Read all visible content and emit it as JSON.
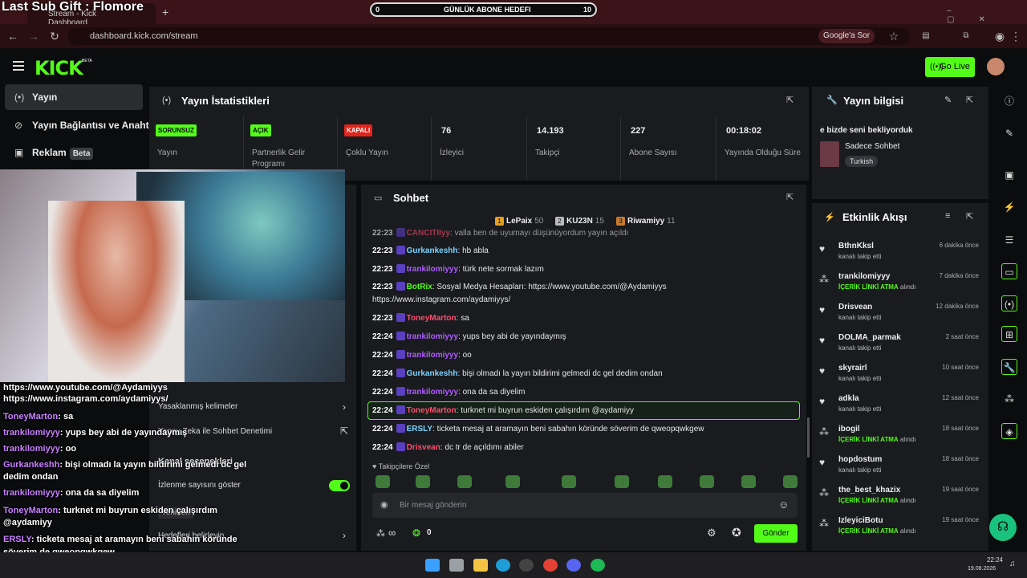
{
  "overlay": {
    "subgift": "Last Sub Gift : Flomore",
    "goal": {
      "label": "GÜNLÜK ABONE HEDEFI",
      "current": "0",
      "target": "10"
    }
  },
  "browser": {
    "tab_title": "Stream - Kick Dashboard",
    "url": "dashboard.kick.com/stream",
    "google_chip": "Google'a Sor"
  },
  "header": {
    "logo": "KICK",
    "beta": "BETA",
    "go_live": "Go Live"
  },
  "nav": {
    "items": [
      {
        "label": "Yayın",
        "icon": "broadcast-icon"
      },
      {
        "label": "Yayın Bağlantısı ve Anahtarı",
        "icon": "link-icon"
      },
      {
        "label": "Reklam",
        "icon": "ad-icon",
        "badge": "Beta"
      }
    ]
  },
  "stats": {
    "title": "Yayın İstatistikleri",
    "items": [
      {
        "tag": "SORUNSUZ",
        "label": "Yayın",
        "color": "#53fc18"
      },
      {
        "tag": "AÇIK",
        "label": "Partnerlik Gelir Programı",
        "color": "#53fc18"
      },
      {
        "tag": "KAPALI",
        "label": "Çoklu Yayın",
        "color": "#e1251b"
      },
      {
        "value": "76",
        "label": "İzleyici"
      },
      {
        "value": "14.193",
        "label": "Takipçi"
      },
      {
        "value": "227",
        "label": "Abone Sayısı"
      },
      {
        "value": "00:18:02",
        "label": "Yayında Olduğu Süre"
      }
    ]
  },
  "info": {
    "title": "Yayın bilgisi",
    "stream_title": "e bizde seni bekliyorduk",
    "category": "Sadece Sohbet",
    "language": "Turkish"
  },
  "chat": {
    "title": "Sohbet",
    "top_gifters": [
      {
        "rank": "1",
        "name": "LePaix",
        "count": "50"
      },
      {
        "rank": "2",
        "name": "KU23N",
        "count": "15"
      },
      {
        "rank": "3",
        "name": "Riwamiyy",
        "count": "11"
      }
    ],
    "messages": [
      {
        "time": "22:23",
        "user": "CANCITIIyy",
        "text": "valla ben de uyumayı düşünüyordum yayın açıldı",
        "color": "#ff4d6d"
      },
      {
        "time": "22:23",
        "user": "Gurkankeshh",
        "text": "hb abla",
        "color": "#7ad4ff"
      },
      {
        "time": "22:23",
        "user": "trankilomiyyy",
        "text": "türk nete sormak lazım",
        "color": "#b05cff"
      },
      {
        "time": "22:23",
        "user": "BotRix",
        "text": "Sosyal Medya Hesapları: https://www.youtube.com/@Aydamiyys",
        "color": "#53fc18"
      },
      {
        "time": "",
        "user": "",
        "text": "https://www.instagram.com/aydamiyys/",
        "color": "#fff"
      },
      {
        "time": "22:23",
        "user": "ToneyMarton",
        "text": "sa",
        "color": "#ff4d6d"
      },
      {
        "time": "22:24",
        "user": "trankilomiyyy",
        "text": "yups bey abi de yayındaymış",
        "color": "#b05cff"
      },
      {
        "time": "22:24",
        "user": "trankilomiyyy",
        "text": "oo",
        "color": "#b05cff"
      },
      {
        "time": "22:24",
        "user": "Gurkankeshh",
        "text": "bişi olmadı la yayın bildirimi gelmedi dc gel dedim ondan",
        "color": "#7ad4ff"
      },
      {
        "time": "22:24",
        "user": "trankilomiyyy",
        "text": "ona da sa diyelim",
        "color": "#b05cff"
      },
      {
        "time": "22:24",
        "user": "ToneyMarton",
        "text": "turknet mi buyrun eskiden çalışırdım @aydamiyy",
        "color": "#ff4d6d"
      },
      {
        "time": "22:24",
        "user": "ERSLY",
        "text": "ticketa mesaj at aramayın beni sabahın köründe söverim de qweopqwkgew",
        "color": "#7ad4ff"
      },
      {
        "time": "22:24",
        "user": "Drisvean",
        "text": "dc tr de açıldımı abiler",
        "color": "#ff4d6d"
      }
    ],
    "followers_only": "Takipçilere Özel",
    "input_placeholder": "Bir mesaj gönderin",
    "infinity": "∞",
    "points": "0",
    "send": "Gönder"
  },
  "events": {
    "title": "Etkinlik Akışı",
    "items": [
      {
        "user": "BthnKksl",
        "desc": "kanalı takip etti",
        "time": "6 dakika önce",
        "icon": "heart-icon"
      },
      {
        "user": "trankilomiyyy",
        "desc_hl": "İÇERİK LİNKİ ATMA",
        "desc": "alındı",
        "time": "7 dakika önce",
        "icon": "reward-icon"
      },
      {
        "user": "Drisvean",
        "desc": "kanalı takip etti",
        "time": "12 dakika önce",
        "icon": "heart-icon"
      },
      {
        "user": "DOLMA_parmak",
        "desc": "kanalı takip etti",
        "time": "2 saat önce",
        "icon": "heart-icon"
      },
      {
        "user": "skyrairl",
        "desc": "kanalı takip etti",
        "time": "10 saat önce",
        "icon": "heart-icon"
      },
      {
        "user": "adkla",
        "desc": "kanalı takip etti",
        "time": "12 saat önce",
        "icon": "heart-icon"
      },
      {
        "user": "ibogil",
        "desc_hl": "İÇERİK LİNKİ ATMA",
        "desc": "alındı",
        "time": "18 saat önce",
        "icon": "reward-icon"
      },
      {
        "user": "hopdostum",
        "desc": "kanalı takip etti",
        "time": "18 saat önce",
        "icon": "heart-icon"
      },
      {
        "user": "the_best_khazix",
        "desc_hl": "İÇERİK LİNKİ ATMA",
        "desc": "alındı",
        "time": "19 saat önce",
        "icon": "reward-icon"
      },
      {
        "user": "IzleyiciBotu",
        "desc_hl": "İÇERİK LİNKİ ATMA",
        "desc": "alındı",
        "time": "19 saat önce",
        "icon": "reward-icon"
      }
    ]
  },
  "obs_chat": [
    {
      "text": "https://www.youtube.com/@Aydamiyys"
    },
    {
      "text": "https://www.instagram.com/aydamiyys/"
    },
    {
      "user": "ToneyMarton",
      "text": "sa"
    },
    {
      "user": "trankilomiyyy",
      "text": "yups bey abi de yayındaymış"
    },
    {
      "user": "trankilomiyyy",
      "text": "oo"
    },
    {
      "user": "Gurkankeshh",
      "text": "bişi olmadı la yayın bildirimi gelmedi dc gel"
    },
    {
      "text": "dedim ondan"
    },
    {
      "user": "trankilomiyyy",
      "text": "ona da sa diyelim"
    },
    {
      "user": "ToneyMarton",
      "text": "turknet mi buyrun eskiden çalışırdım"
    },
    {
      "text": "@aydamiyy"
    },
    {
      "user": "ERSLY",
      "text": "ticketa mesaj at aramayın beni sabahın köründe"
    },
    {
      "text": "söverim de qweopqwkgew"
    },
    {
      "user": "Drisvean",
      "text": "dc tr de açıldımı abiler"
    }
  ],
  "settings_behind": {
    "banned_words": "Yasaklanmış kelimeler",
    "ai_mod": "Yapay Zeka ile Sohbet Denetimi",
    "channel_options": "Kanal seçenekleri",
    "show_viewers": "İzlenme sayısını göster",
    "set_goals": "Hedefleri belirleyin",
    "reset": "Yeniden"
  },
  "taskbar": {
    "time": "22:24",
    "date": "19.08.2026"
  },
  "colors": {
    "accent": "#53fc18",
    "panel": "#191b1f",
    "bg": "#0b0c0d"
  }
}
